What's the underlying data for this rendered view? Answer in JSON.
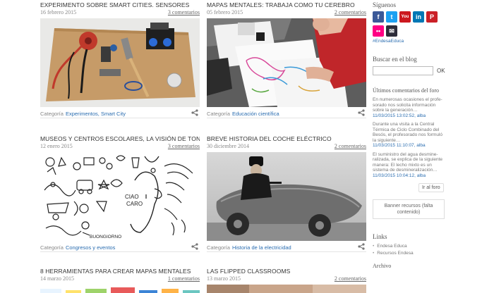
{
  "posts": [
    {
      "title": "EXPERIMENTO SOBRE SMART CITIES. SENSORES",
      "date": "16 febrero 2015",
      "comments": "3 comentarios",
      "category_label": "Categoría",
      "category": "Experimentos, Smart City"
    },
    {
      "title": "MAPAS MENTALES: TRABAJA COMO TU CEREBRO",
      "date": "05 febrero 2015",
      "comments": "2 comentarios",
      "category_label": "Categoría",
      "category": "Educación científica"
    },
    {
      "title": "MUSEOS Y CENTROS ESCOLARES, LA VISIÓN DE TONUCCI",
      "date": "12 enero 2015",
      "comments": "3 comentarios",
      "category_label": "Categoría",
      "category": "Congresos y eventos"
    },
    {
      "title": "BREVE HISTORIA DEL COCHE ELÉCTRICO",
      "date": "30 diciembre 2014",
      "comments": "2 comentarios",
      "category_label": "Categoría",
      "category": "Historia de la electricidad"
    },
    {
      "title": "8 HERRAMIENTAS PARA CREAR MAPAS MENTALES",
      "date": "14 marzo 2015",
      "comments": "1 comentarios"
    },
    {
      "title": "LAS FLIPPED CLASSROOMS",
      "date": "13 marzo 2015",
      "comments": "2 comentarios"
    }
  ],
  "cartoon_text": {
    "ciao": "CIAO",
    "caro": "CARO",
    "buongiorno": "BUONGIORNO"
  },
  "sidebar": {
    "follow_title": "Síguenos",
    "social": [
      {
        "name": "facebook-icon",
        "glyph": "f",
        "color": "#3b5998"
      },
      {
        "name": "twitter-icon",
        "glyph": "t",
        "color": "#1da1f2"
      },
      {
        "name": "youtube-icon",
        "glyph": "You",
        "color": "#cc181e"
      },
      {
        "name": "linkedin-icon",
        "glyph": "in",
        "color": "#0077b5"
      },
      {
        "name": "pinterest-icon",
        "glyph": "P",
        "color": "#cb2027"
      },
      {
        "name": "flickr-icon",
        "glyph": "••",
        "color": "#ff0084"
      },
      {
        "name": "email-icon",
        "glyph": "✉",
        "color": "#2d2d3a"
      }
    ],
    "hashtag": "#EndesaEduca",
    "search_title": "Buscar en el blog",
    "search_ok": "OK",
    "comments_title": "Últimos comentarios del foro",
    "comments": [
      {
        "text": "En numerosas ocasiones el profe-sorado nos solicita información sobre la generación…",
        "when": "11/03/2015 13:02:52, alba"
      },
      {
        "text": "Durante una visita a la Central Térmica de Ciclo Combinado del Besós, el profesorado nos formuló la siguiente…",
        "when": "11/03/2015 11:10:07, alba"
      },
      {
        "text": "El suministro del agua desmine-ralizada, se explica de la siguiente manera: El lecho mixto es un sistema de desmineralización…",
        "when": "11/03/2015 10:04:12, alba"
      }
    ],
    "all_forum": "Ir al foro",
    "banner": "Banner recursos (falta contenido)",
    "links_title": "Links",
    "links": [
      "Endesa Educa",
      "Recursos Endesa"
    ],
    "archive_title": "Archivo"
  }
}
